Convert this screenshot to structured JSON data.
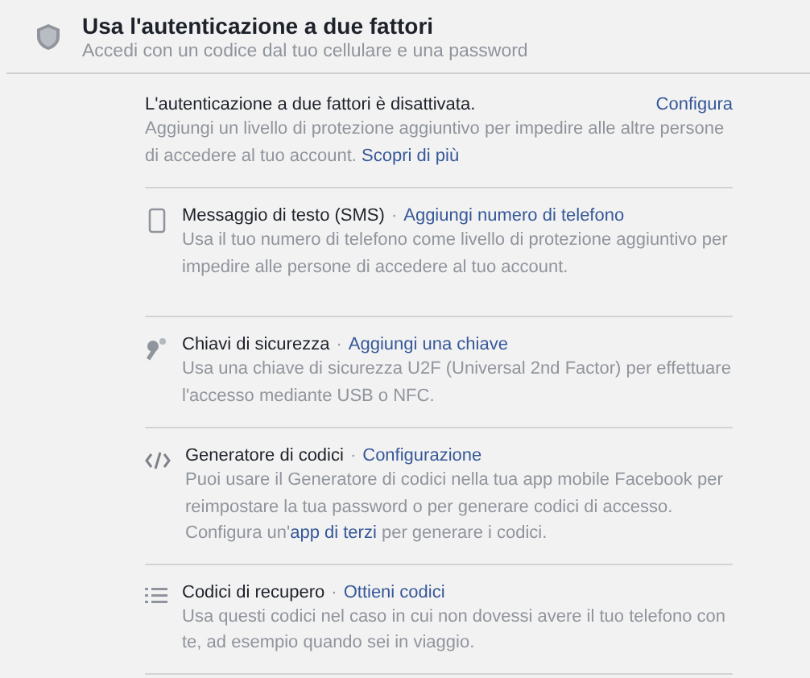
{
  "header": {
    "title": "Usa l'autenticazione a due fattori",
    "subtitle": "Accedi con un codice dal tuo cellulare e una password"
  },
  "status": {
    "text": "L'autenticazione a due fattori è disattivata.",
    "action": "Configura",
    "description": [
      {
        "kind": "text",
        "text": "Aggiungi un livello di protezione aggiuntivo per impedire alle altre persone di accedere al tuo account. "
      },
      {
        "kind": "link",
        "text": "Scopri di più"
      }
    ]
  },
  "methods": [
    {
      "kind": "phone",
      "title": "Messaggio di testo (SMS)",
      "separator": "·",
      "action": "Aggiungi numero di telefono",
      "description": [
        {
          "kind": "text",
          "text": "Usa il tuo numero di telefono come livello di protezione aggiuntivo per impedire alle persone di accedere al tuo account."
        }
      ]
    },
    {
      "kind": "key",
      "title": "Chiavi di sicurezza",
      "separator": "·",
      "action": "Aggiungi una chiave",
      "description": [
        {
          "kind": "text",
          "text": "Usa una chiave di sicurezza U2F (Universal 2nd Factor) per effettuare l'accesso mediante USB o NFC."
        }
      ]
    },
    {
      "kind": "code",
      "title": "Generatore di codici",
      "separator": "·",
      "action": "Configurazione",
      "description": [
        {
          "kind": "text",
          "text": "Puoi usare il Generatore di codici nella tua app mobile Facebook per reimpostare la tua password o per generare codici di accesso. Configura un'"
        },
        {
          "kind": "link",
          "text": "app di terzi"
        },
        {
          "kind": "text",
          "text": " per generare i codici."
        }
      ]
    },
    {
      "kind": "list",
      "title": "Codici di recupero",
      "separator": "·",
      "action": "Ottieni codici",
      "description": [
        {
          "kind": "text",
          "text": "Usa questi codici nel caso in cui non dovessi avere il tuo telefono con te, ad esempio quando sei in viaggio."
        }
      ]
    }
  ]
}
